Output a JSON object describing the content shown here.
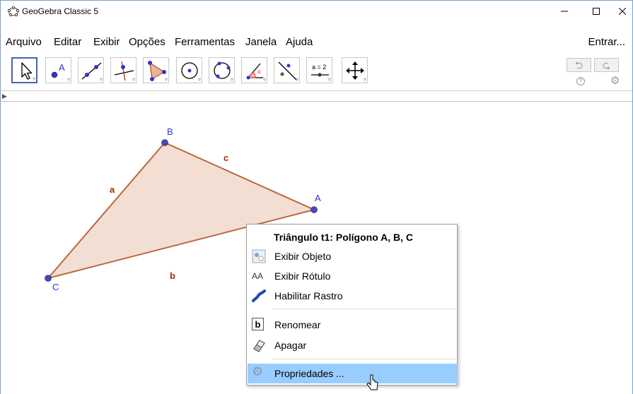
{
  "window": {
    "title": "GeoGebra Classic 5"
  },
  "menu": {
    "items": [
      "Arquivo",
      "Editar",
      "Exibir",
      "Opções",
      "Ferramentas",
      "Janela",
      "Ajuda"
    ],
    "login": "Entrar..."
  },
  "toolbar": {
    "tools": [
      {
        "name": "move-tool-icon",
        "active": true
      },
      {
        "name": "point-tool-icon",
        "label": "A"
      },
      {
        "name": "line-tool-icon"
      },
      {
        "name": "perpendicular-line-tool-icon"
      },
      {
        "name": "polygon-tool-icon"
      },
      {
        "name": "circle-center-point-tool-icon"
      },
      {
        "name": "circle-three-points-tool-icon"
      },
      {
        "name": "angle-tool-icon"
      },
      {
        "name": "reflect-tool-icon"
      },
      {
        "name": "slider-tool-icon",
        "label": "a = 2"
      },
      {
        "name": "move-graphics-view-tool-icon"
      }
    ],
    "undo_icon": "undo-icon",
    "redo_icon": "redo-icon",
    "help_symbol": "?"
  },
  "graphics": {
    "points": {
      "A": "A",
      "B": "B",
      "C": "C"
    },
    "segments": {
      "a": "a",
      "b": "b",
      "c": "c"
    },
    "colors": {
      "fill": "#f3ded3",
      "stroke": "#b86a3d",
      "point": "#4444cc",
      "label_point": "#3333cc",
      "label_segment": "#993300"
    }
  },
  "context_menu": {
    "title": "Triângulo t1: Polígono A, B, C",
    "items": [
      {
        "icon": "show-object-icon",
        "label": "Exibir Objeto"
      },
      {
        "icon": "show-label-icon",
        "label": "Exibir Rótulo",
        "icon_text": "AA"
      },
      {
        "icon": "trace-icon",
        "label": "Habilitar Rastro"
      },
      {
        "icon": "rename-icon",
        "label": "Renomear",
        "icon_text": "b"
      },
      {
        "icon": "eraser-icon",
        "label": "Apagar"
      },
      {
        "icon": "gear-icon",
        "label": "Propriedades ..."
      }
    ],
    "highlight_color": "#99ccff"
  }
}
